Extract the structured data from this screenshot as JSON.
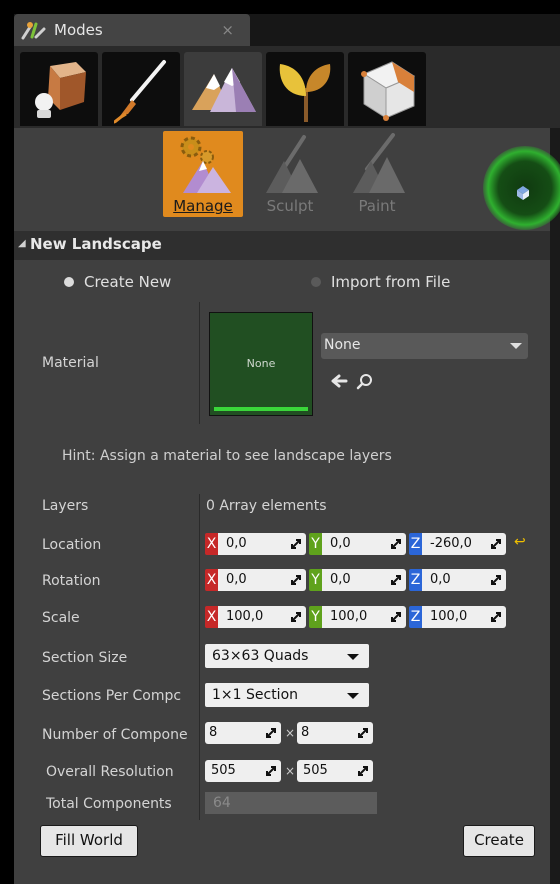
{
  "window": {
    "tab_title": "Modes",
    "close_glyph": "×",
    "tab_icon": "modes-icon"
  },
  "mode_tabs": [
    {
      "name": "place-mode",
      "icon": "place-icon",
      "active": false
    },
    {
      "name": "paint-mode",
      "icon": "mesh-paint-icon",
      "active": false
    },
    {
      "name": "landscape-mode",
      "icon": "landscape-icon",
      "active": true
    },
    {
      "name": "foliage-mode",
      "icon": "foliage-icon",
      "active": false
    },
    {
      "name": "geometry-mode",
      "icon": "geometry-edit-icon",
      "active": false
    }
  ],
  "tools": {
    "manage": "Manage",
    "sculpt": "Sculpt",
    "paint": "Paint"
  },
  "section": {
    "title": "New Landscape",
    "expanded": true
  },
  "source": {
    "create_new": "Create New",
    "import_file": "Import from File",
    "selected": "create_new"
  },
  "material": {
    "label": "Material",
    "thumb_text": "None",
    "combo_value": "None",
    "icons": [
      "arrow-left-icon",
      "search-icon"
    ]
  },
  "hint": "Hint: Assign a material to see landscape layers",
  "layers": {
    "label": "Layers",
    "value": "0 Array elements"
  },
  "location": {
    "label": "Location",
    "x": "0,0",
    "y": "0,0",
    "z": "-260,0",
    "axis_x": "X",
    "axis_y": "Y",
    "axis_z": "Z"
  },
  "rotation": {
    "label": "Rotation",
    "x": "0,0",
    "y": "0,0",
    "z": "0,0",
    "axis_x": "X",
    "axis_y": "Y",
    "axis_z": "Z"
  },
  "scale": {
    "label": "Scale",
    "x": "100,0",
    "y": "100,0",
    "z": "100,0",
    "axis_x": "X",
    "axis_y": "Y",
    "axis_z": "Z"
  },
  "section_size": {
    "label": "Section Size",
    "value": "63×63 Quads"
  },
  "sections_per_component": {
    "label": "Sections Per Compc",
    "value": "1×1 Section"
  },
  "number_of_components": {
    "label": "Number of Compone",
    "x": "8",
    "y": "8",
    "sep": "×"
  },
  "overall_resolution": {
    "label": "Overall Resolution",
    "x": "505",
    "y": "505",
    "sep": "×"
  },
  "total_components": {
    "label": "Total Components",
    "value": "64"
  },
  "buttons": {
    "fill_world": "Fill World",
    "create": "Create"
  },
  "colors": {
    "active_tool": "#e08a1e",
    "axis_x": "#c62828",
    "axis_y": "#5fa21c",
    "axis_z": "#2b66d8",
    "material_green": "#214f22"
  }
}
